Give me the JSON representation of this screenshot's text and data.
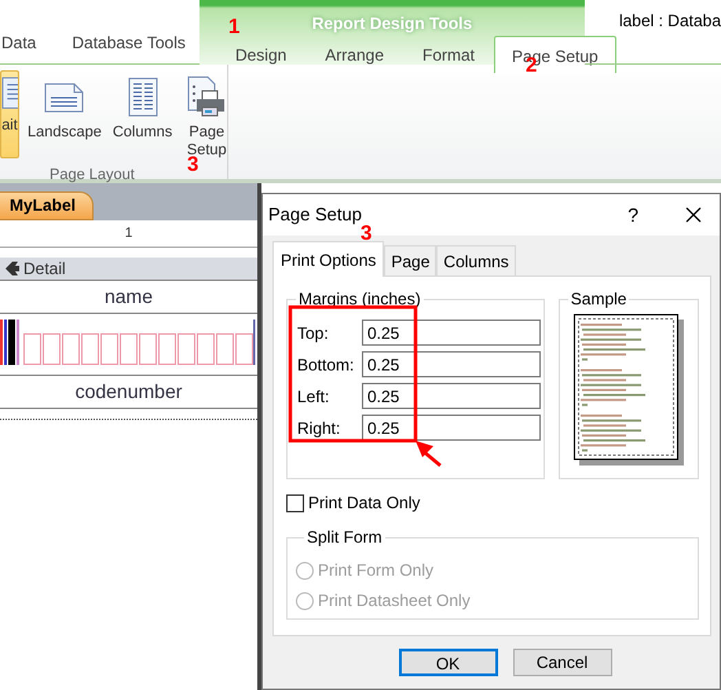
{
  "window": {
    "title": "label : Databa"
  },
  "ribbon_tabs": [
    {
      "label": "Data",
      "selected": false,
      "contextual": false
    },
    {
      "label": "Database Tools",
      "selected": false,
      "contextual": false
    },
    {
      "label": "Design",
      "selected": false,
      "contextual": true
    },
    {
      "label": "Arrange",
      "selected": false,
      "contextual": true
    },
    {
      "label": "Format",
      "selected": false,
      "contextual": true
    },
    {
      "label": "Page Setup",
      "selected": true,
      "contextual": true
    }
  ],
  "contextual_group": {
    "title": "Report Design Tools"
  },
  "ribbon_buttons": [
    {
      "label": "ait",
      "kind": "portrait",
      "selected": true
    },
    {
      "label": "Landscape",
      "kind": "landscape",
      "selected": false
    },
    {
      "label": "Columns",
      "kind": "columns",
      "selected": false
    },
    {
      "label": "Page Setup",
      "kind": "setup",
      "selected": false
    }
  ],
  "ribbon_group": {
    "label": "Page Layout"
  },
  "document_tab": {
    "label": "MyLabel"
  },
  "ruler": {
    "mark": "1"
  },
  "section": {
    "label": "Detail"
  },
  "report_fields": [
    "name",
    "codenumber"
  ],
  "dialog": {
    "title": "Page Setup",
    "help": "?",
    "tabs": [
      {
        "label": "Print Options",
        "selected": true
      },
      {
        "label": "Page",
        "selected": false
      },
      {
        "label": "Columns",
        "selected": false
      }
    ],
    "margins": {
      "title": "Margins (inches)",
      "fields": [
        {
          "label": "Top:",
          "value": "0.25"
        },
        {
          "label": "Bottom:",
          "value": "0.25"
        },
        {
          "label": "Left:",
          "value": "0.25"
        },
        {
          "label": "Right:",
          "value": "0.25"
        }
      ]
    },
    "sample": {
      "title": "Sample"
    },
    "print_data_only": {
      "label": "Print Data Only",
      "checked": false
    },
    "split_form": {
      "title": "Split Form",
      "disabled": true,
      "options": [
        {
          "label": "Print Form Only",
          "selected": false
        },
        {
          "label": "Print Datasheet Only",
          "selected": false
        }
      ]
    },
    "buttons": [
      {
        "label": "OK",
        "default": true
      },
      {
        "label": "Cancel",
        "default": false
      }
    ]
  },
  "annotations": [
    {
      "label": "1"
    },
    {
      "label": "2"
    },
    {
      "label": "3"
    },
    {
      "label": "3"
    }
  ]
}
